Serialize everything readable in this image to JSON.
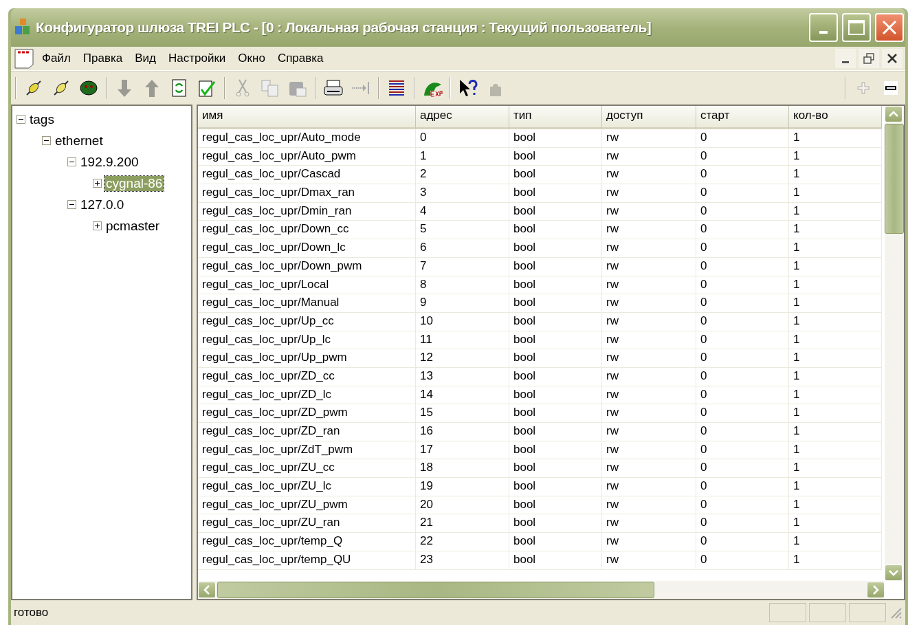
{
  "window": {
    "title": "Конфигуратор шлюза TREI PLC - [0 : Локальная рабочая станция : Текущий пользователь]"
  },
  "menu": [
    "Файл",
    "Правка",
    "Вид",
    "Настройки",
    "Окно",
    "Справка"
  ],
  "tree": [
    {
      "label": "tags",
      "expanded": true,
      "selected": false,
      "children": [
        {
          "label": "ethernet",
          "expanded": true,
          "selected": false,
          "children": [
            {
              "label": "192.9.200",
              "expanded": true,
              "selected": false,
              "children": [
                {
                  "label": "cygnal-86",
                  "expanded": false,
                  "selected": true
                }
              ]
            },
            {
              "label": "127.0.0",
              "expanded": true,
              "selected": false,
              "children": [
                {
                  "label": "pcmaster",
                  "expanded": false,
                  "selected": false
                }
              ]
            }
          ]
        }
      ]
    }
  ],
  "table": {
    "columns": [
      "имя",
      "адрес",
      "тип",
      "доступ",
      "старт",
      "кол-во"
    ],
    "rows": [
      [
        "regul_cas_loc_upr/Auto_mode",
        "0",
        "bool",
        "rw",
        "0",
        "1"
      ],
      [
        "regul_cas_loc_upr/Auto_pwm",
        "1",
        "bool",
        "rw",
        "0",
        "1"
      ],
      [
        "regul_cas_loc_upr/Cascad",
        "2",
        "bool",
        "rw",
        "0",
        "1"
      ],
      [
        "regul_cas_loc_upr/Dmax_ran",
        "3",
        "bool",
        "rw",
        "0",
        "1"
      ],
      [
        "regul_cas_loc_upr/Dmin_ran",
        "4",
        "bool",
        "rw",
        "0",
        "1"
      ],
      [
        "regul_cas_loc_upr/Down_cc",
        "5",
        "bool",
        "rw",
        "0",
        "1"
      ],
      [
        "regul_cas_loc_upr/Down_lc",
        "6",
        "bool",
        "rw",
        "0",
        "1"
      ],
      [
        "regul_cas_loc_upr/Down_pwm",
        "7",
        "bool",
        "rw",
        "0",
        "1"
      ],
      [
        "regul_cas_loc_upr/Local",
        "8",
        "bool",
        "rw",
        "0",
        "1"
      ],
      [
        "regul_cas_loc_upr/Manual",
        "9",
        "bool",
        "rw",
        "0",
        "1"
      ],
      [
        "regul_cas_loc_upr/Up_cc",
        "10",
        "bool",
        "rw",
        "0",
        "1"
      ],
      [
        "regul_cas_loc_upr/Up_lc",
        "11",
        "bool",
        "rw",
        "0",
        "1"
      ],
      [
        "regul_cas_loc_upr/Up_pwm",
        "12",
        "bool",
        "rw",
        "0",
        "1"
      ],
      [
        "regul_cas_loc_upr/ZD_cc",
        "13",
        "bool",
        "rw",
        "0",
        "1"
      ],
      [
        "regul_cas_loc_upr/ZD_lc",
        "14",
        "bool",
        "rw",
        "0",
        "1"
      ],
      [
        "regul_cas_loc_upr/ZD_pwm",
        "15",
        "bool",
        "rw",
        "0",
        "1"
      ],
      [
        "regul_cas_loc_upr/ZD_ran",
        "16",
        "bool",
        "rw",
        "0",
        "1"
      ],
      [
        "regul_cas_loc_upr/ZdT_pwm",
        "17",
        "bool",
        "rw",
        "0",
        "1"
      ],
      [
        "regul_cas_loc_upr/ZU_cc",
        "18",
        "bool",
        "rw",
        "0",
        "1"
      ],
      [
        "regul_cas_loc_upr/ZU_lc",
        "19",
        "bool",
        "rw",
        "0",
        "1"
      ],
      [
        "regul_cas_loc_upr/ZU_pwm",
        "20",
        "bool",
        "rw",
        "0",
        "1"
      ],
      [
        "regul_cas_loc_upr/ZU_ran",
        "21",
        "bool",
        "rw",
        "0",
        "1"
      ],
      [
        "regul_cas_loc_upr/temp_Q",
        "22",
        "bool",
        "rw",
        "0",
        "1"
      ],
      [
        "regul_cas_loc_upr/temp_QU",
        "23",
        "bool",
        "rw",
        "0",
        "1"
      ]
    ]
  },
  "status_bar": {
    "text": "готово"
  }
}
